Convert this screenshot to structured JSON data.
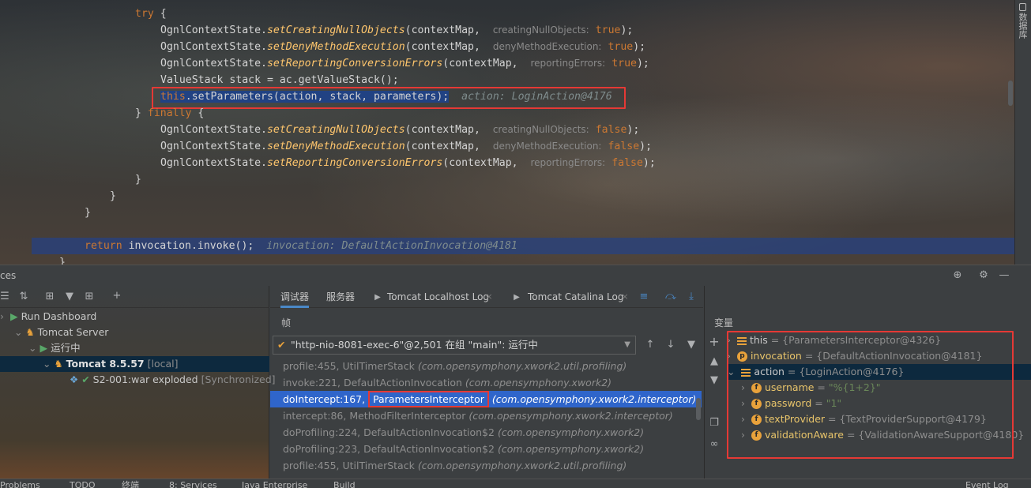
{
  "editor": {
    "lines": {
      "try_kw": "try",
      "try_brace": " {",
      "l1_cls": "OgnlContextState.",
      "l1_fn": "setCreatingNullObjects",
      "l1_args": "(contextMap,",
      "l1_hint": "creatingNullObjects:",
      "l1_val": "true",
      "l1_end": ");",
      "l2_cls": "OgnlContextState.",
      "l2_fn": "setDenyMethodExecution",
      "l2_args": "(contextMap,",
      "l2_hint": "denyMethodExecution:",
      "l2_val": "true",
      "l2_end": ");",
      "l3_cls": "OgnlContextState.",
      "l3_fn": "setReportingConversionErrors",
      "l3_args": "(contextMap,",
      "l3_hint": "reportingErrors:",
      "l3_val": "true",
      "l3_end": ");",
      "l4": "ValueStack stack = ac.getValueStack();",
      "l5_kw": "this",
      "l5_rest": ".setParameters(action, stack, parameters);",
      "l5_dbg": "action: LoginAction@4176",
      "finally_open": "} ",
      "finally_kw": "finally",
      "finally_brace": " {",
      "l6_cls": "OgnlContextState.",
      "l6_fn": "setCreatingNullObjects",
      "l6_args": "(contextMap,",
      "l6_hint": "creatingNullObjects:",
      "l6_val": "false",
      "l6_end": ");",
      "l7_cls": "OgnlContextState.",
      "l7_fn": "setDenyMethodExecution",
      "l7_args": "(contextMap,",
      "l7_hint": "denyMethodExecution:",
      "l7_val": "false",
      "l7_end": ");",
      "l8_cls": "OgnlContextState.",
      "l8_fn": "setReportingConversionErrors",
      "l8_args": "(contextMap,",
      "l8_hint": "reportingErrors:",
      "l8_val": "false",
      "l8_end": ");",
      "close1": "}",
      "close2": "}",
      "close3": "}",
      "ret_kw": "return",
      "ret_rest": " invocation.invoke();",
      "ret_dbg": "invocation: DefaultActionInvocation@4181",
      "last_brace": "}"
    },
    "right_stripe_label": "数据库"
  },
  "toolwindow": {
    "title": "ces",
    "services": {
      "run_dashboard": "Run Dashboard",
      "tomcat_server": "Tomcat Server",
      "running": "运行中",
      "tomcat_name": "Tomcat 8.5.57",
      "tomcat_local": "[local]",
      "artifact": "S2-001:war exploded",
      "artifact_status": "[Synchronized]"
    },
    "debug": {
      "tabs": {
        "debugger": "调试器",
        "server": "服务器",
        "localhost_log": "Tomcat Localhost Log",
        "catalina_log": "Tomcat Catalina Log"
      },
      "frames_title": "帧",
      "thread": "\"http-nio-8081-exec-6\"@2,501 在组 \"main\": 运行中",
      "frames": [
        {
          "method": "profile:455, UtilTimerStack",
          "pkg": "(com.opensymphony.xwork2.util.profiling)"
        },
        {
          "method": "invoke:221, DefaultActionInvocation",
          "pkg": "(com.opensymphony.xwork2)"
        },
        {
          "method_a": "doIntercept:167,",
          "method_b": "ParametersInterceptor",
          "pkg": "(com.opensymphony.xwork2.interceptor)"
        },
        {
          "method": "intercept:86, MethodFilterInterceptor",
          "pkg": "(com.opensymphony.xwork2.interceptor)"
        },
        {
          "method": "doProfiling:224, DefaultActionInvocation$2",
          "pkg": "(com.opensymphony.xwork2)"
        },
        {
          "method": "doProfiling:223, DefaultActionInvocation$2",
          "pkg": "(com.opensymphony.xwork2)"
        },
        {
          "method": "profile:455, UtilTimerStack",
          "pkg": "(com.opensymphony.xwork2.util.profiling)"
        }
      ]
    },
    "variables": {
      "title": "变量",
      "rows": [
        {
          "name": "this",
          "value": " = {ParametersInterceptor@4326}"
        },
        {
          "name": "invocation",
          "value": " = {DefaultActionInvocation@4181}"
        },
        {
          "name": "action",
          "value": " = {LoginAction@4176}"
        },
        {
          "name": "username",
          "value": " = ",
          "str": "\"%{1+2}\""
        },
        {
          "name": "password",
          "value": " = ",
          "str": "\"1\""
        },
        {
          "name": "textProvider",
          "value": " = {TextProviderSupport@4179}"
        },
        {
          "name": "validationAware",
          "value": " = {ValidationAwareSupport@4180}"
        }
      ]
    }
  },
  "status_bar": {
    "problems": "Problems",
    "todo": "TODO",
    "terminal": "终端",
    "services": "8: Services",
    "java_enterprise": "Java Enterprise",
    "build": "Build",
    "event_log": "Event Log"
  },
  "colors": {
    "highlight_red": "#e53935",
    "selection_blue": "#2f65ca",
    "keyword_orange": "#cc7832"
  }
}
